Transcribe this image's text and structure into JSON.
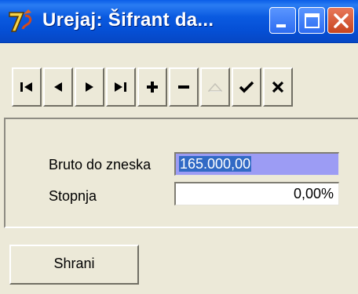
{
  "window": {
    "title": "Urejaj: Šifrant da...",
    "title_bar_color": "#0550d6"
  },
  "title_buttons": [
    "minimize-icon",
    "maximize-icon",
    "close-icon"
  ],
  "navigator": {
    "buttons": [
      {
        "name": "first-record-button",
        "icon": "first-icon",
        "enabled": true
      },
      {
        "name": "prior-record-button",
        "icon": "prior-icon",
        "enabled": true
      },
      {
        "name": "next-record-button",
        "icon": "next-icon",
        "enabled": true
      },
      {
        "name": "last-record-button",
        "icon": "last-icon",
        "enabled": true
      },
      {
        "name": "insert-record-button",
        "icon": "plus-icon",
        "enabled": true
      },
      {
        "name": "delete-record-button",
        "icon": "minus-icon",
        "enabled": true
      },
      {
        "name": "edit-record-button",
        "icon": "triangle-up-icon",
        "enabled": false
      },
      {
        "name": "post-record-button",
        "icon": "check-icon",
        "enabled": true
      },
      {
        "name": "cancel-record-button",
        "icon": "cross-icon",
        "enabled": true
      }
    ]
  },
  "form": {
    "bruto_label": "Bruto do zneska",
    "bruto_value": "165.000,00",
    "stopnja_label": "Stopnja",
    "stopnja_value": "0,00%",
    "selection_color": "#316ac5"
  },
  "actions": {
    "save_label": "Shrani"
  }
}
